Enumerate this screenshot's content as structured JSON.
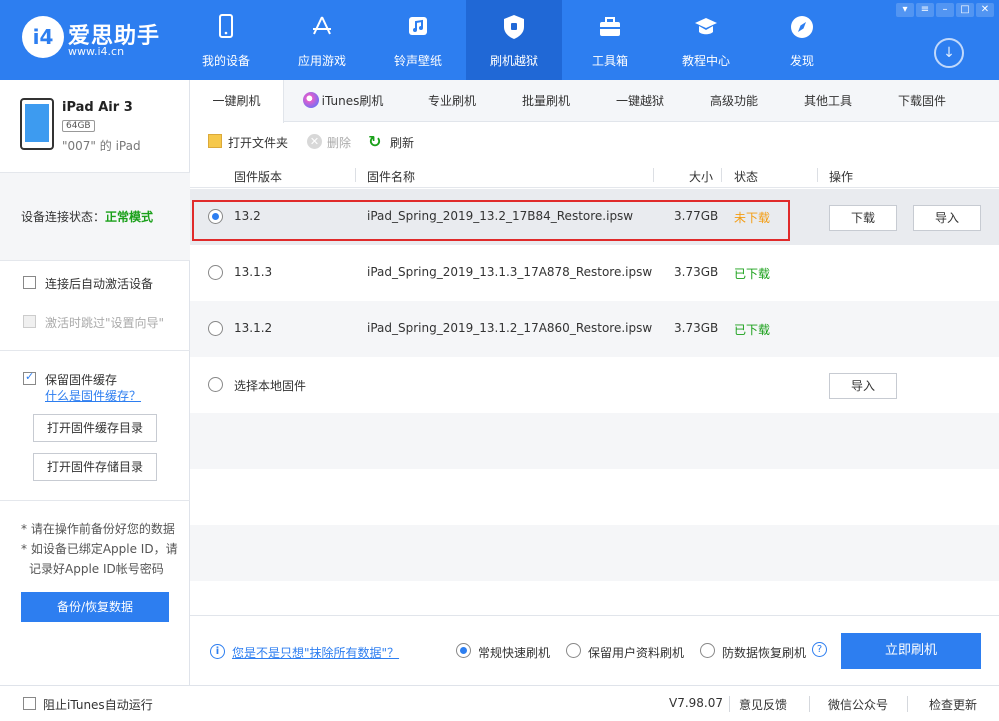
{
  "app": {
    "logo_mark": "i4",
    "name": "爱思助手",
    "url": "www.i4.cn"
  },
  "nav": {
    "items": [
      {
        "label": "我的设备",
        "icon": "phone-icon"
      },
      {
        "label": "应用游戏",
        "icon": "app-store-icon"
      },
      {
        "label": "铃声壁纸",
        "icon": "music-icon"
      },
      {
        "label": "刷机越狱",
        "icon": "shield-icon",
        "active": true
      },
      {
        "label": "工具箱",
        "icon": "toolbox-icon"
      },
      {
        "label": "教程中心",
        "icon": "graduation-cap-icon"
      },
      {
        "label": "发现",
        "icon": "compass-icon"
      }
    ],
    "download_icon": "download-circle-icon"
  },
  "device": {
    "name": "iPad Air 3",
    "capacity": "64GB",
    "nickname": "\"007\" 的 iPad"
  },
  "sidebar": {
    "conn_label": "设备连接状态：",
    "conn_value": "正常模式",
    "auto_activate": "连接后自动激活设备",
    "skip_setup": "激活时跳过\"设置向导\"",
    "keep_cache": "保留固件缓存",
    "what_is_cache": "什么是固件缓存？",
    "open_cache_dir": "打开固件缓存目录",
    "open_storage_dir": "打开固件存储目录",
    "note1": "* 请在操作前备份好您的数据",
    "note2": "* 如设备已绑定Apple ID，请",
    "note3": "记录好Apple ID帐号密码",
    "backup_btn": "备份/恢复数据"
  },
  "tabs": [
    "一键刷机",
    "iTunes刷机",
    "专业刷机",
    "批量刷机",
    "一键越狱",
    "高级功能",
    "其他工具",
    "下载固件"
  ],
  "toolbar": {
    "open_folder": "打开文件夹",
    "delete": "删除",
    "refresh": "刷新"
  },
  "table": {
    "headers": {
      "version": "固件版本",
      "name": "固件名称",
      "size": "大小",
      "status": "状态",
      "action": "操作"
    },
    "rows": [
      {
        "version": "13.2",
        "name": "iPad_Spring_2019_13.2_17B84_Restore.ipsw",
        "size": "3.77GB",
        "status": "未下载",
        "selected": true,
        "btn_download": "下载",
        "btn_import": "导入"
      },
      {
        "version": "13.1.3",
        "name": "iPad_Spring_2019_13.1.3_17A878_Restore.ipsw",
        "size": "3.73GB",
        "status": "已下载"
      },
      {
        "version": "13.1.2",
        "name": "iPad_Spring_2019_13.1.2_17A860_Restore.ipsw",
        "size": "3.73GB",
        "status": "已下载"
      },
      {
        "version": "选择本地固件",
        "btn_import": "导入"
      }
    ]
  },
  "bottom": {
    "erase_link": "您是不是只想\"抹除所有数据\"？",
    "opt_quick": "常规快速刷机",
    "opt_keep": "保留用户资料刷机",
    "opt_recover": "防数据恢复刷机",
    "flash_btn": "立即刷机"
  },
  "statusbar": {
    "block_itunes": "阻止iTunes自动运行",
    "version": "V7.98.07",
    "feedback": "意见反馈",
    "wechat": "微信公众号",
    "update": "检查更新"
  },
  "colors": {
    "accent": "#2d7ef0",
    "success": "#1aa01a",
    "warning": "#f39c12",
    "highlight": "#e02a2a"
  }
}
